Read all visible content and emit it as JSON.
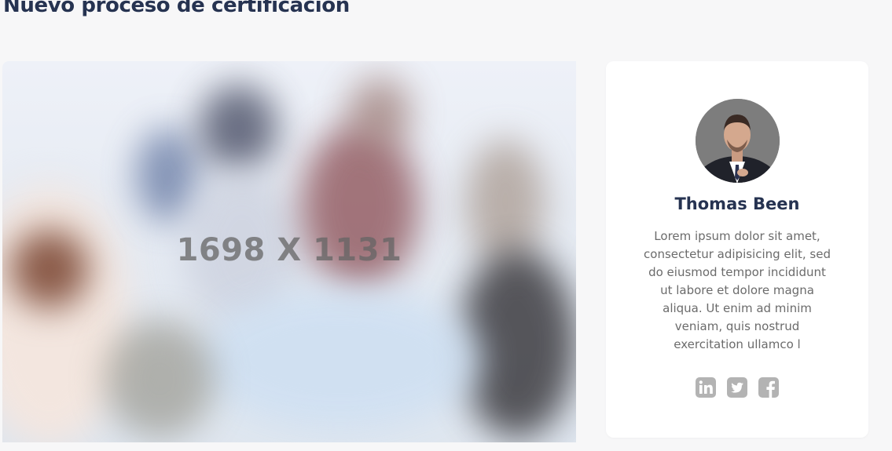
{
  "page": {
    "title": "Nuevo proceso de certificación"
  },
  "hero": {
    "placeholder_label": "1698 X 1131"
  },
  "profile": {
    "name": "Thomas Been",
    "bio": "Lorem ipsum dolor sit amet, consectetur adipisicing elit, sed do eiusmod tempor incididunt ut labore et dolore magna aliqua. Ut enim ad minim veniam, quis nostrud exercitation ullamco l",
    "socials": [
      {
        "icon": "linkedin-icon"
      },
      {
        "icon": "twitter-icon"
      },
      {
        "icon": "facebook-icon"
      }
    ]
  },
  "colors": {
    "heading": "#263351",
    "body_text": "#6b6b6b",
    "icon": "#b3b3b3",
    "card_bg": "#ffffff",
    "page_bg": "#f7f7f8"
  }
}
